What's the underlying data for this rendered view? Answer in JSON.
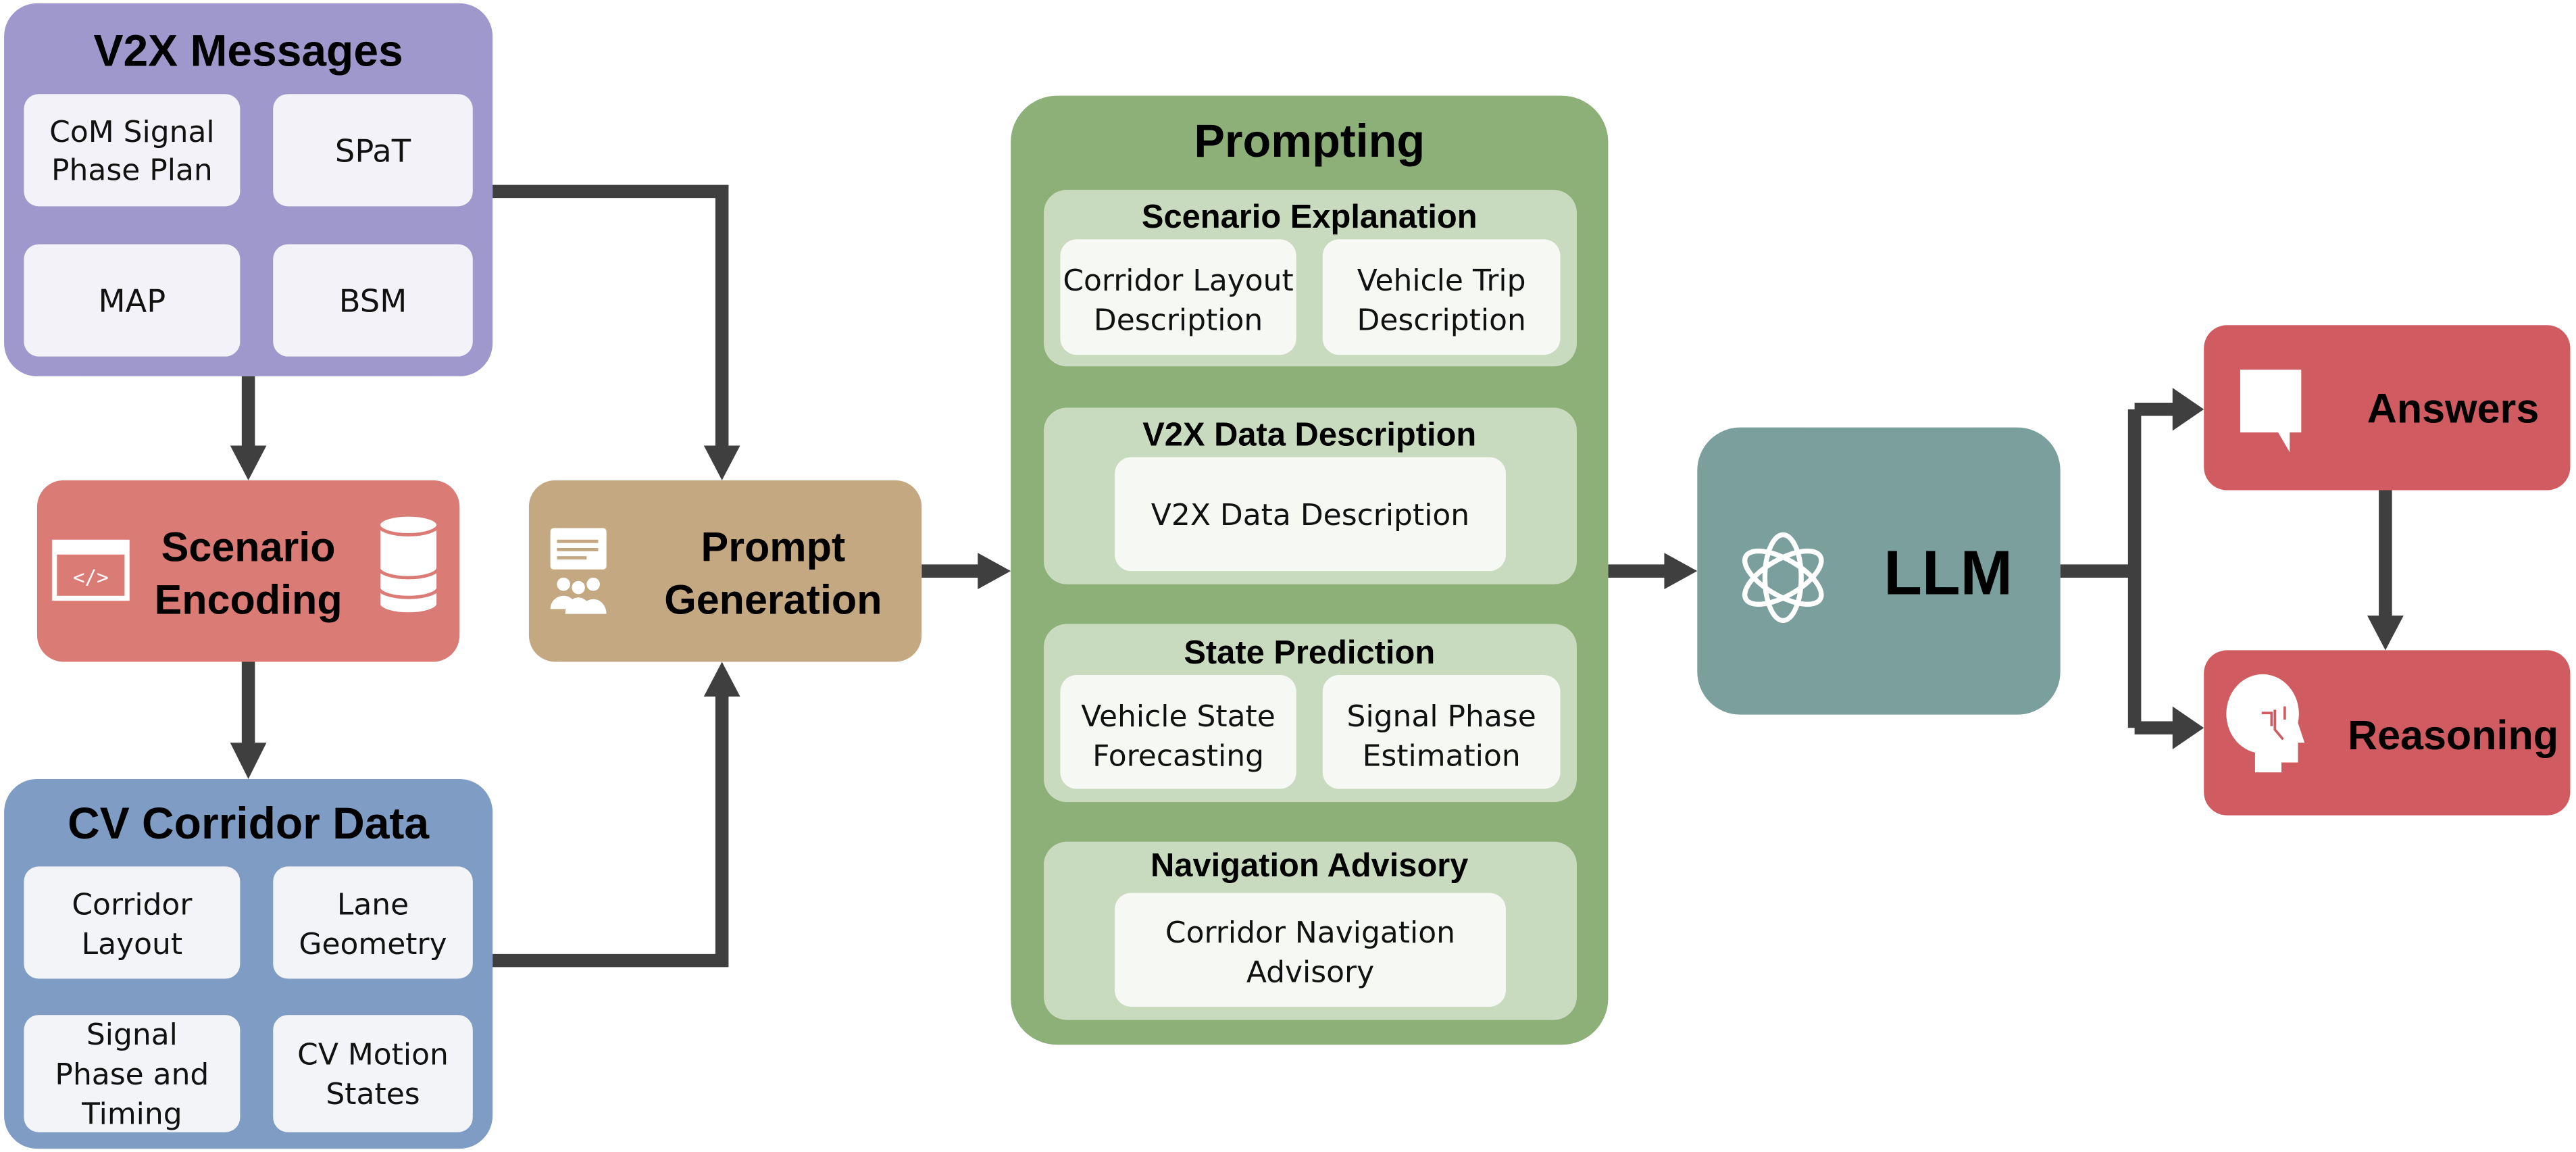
{
  "colors": {
    "v2x": "#9e98cc",
    "encoding": "#db7b76",
    "corridor": "#7f9cc4",
    "prompt_gen": "#c4a882",
    "prompting": "#8daf78",
    "prompting_section": "#c9dbbe",
    "llm": "#7b9f9c",
    "output": "#d05b61",
    "arrow": "#3f3f3f"
  },
  "v2x": {
    "title": "V2X Messages",
    "items": [
      [
        "CoM Signal",
        "Phase Plan"
      ],
      [
        "SPaT"
      ],
      [
        "MAP"
      ],
      [
        "BSM"
      ]
    ]
  },
  "encoding": {
    "title": [
      "Scenario",
      "Encoding"
    ],
    "icons": [
      "code-window-icon",
      "database-icon"
    ]
  },
  "corridor": {
    "title": "CV Corridor Data",
    "items": [
      [
        "Corridor",
        "Layout"
      ],
      [
        "Lane",
        "Geometry"
      ],
      [
        "Signal",
        "Phase and",
        "Timing"
      ],
      [
        "CV Motion",
        "States"
      ]
    ]
  },
  "prompt_gen": {
    "title": [
      "Prompt",
      "Generation"
    ],
    "icon": "people-speech-icon"
  },
  "prompting": {
    "title": "Prompting",
    "sections": [
      {
        "title": "Scenario Explanation",
        "items": [
          [
            "Corridor Layout",
            "Description"
          ],
          [
            "Vehicle Trip",
            "Description"
          ]
        ]
      },
      {
        "title": "V2X Data Description",
        "items": [
          [
            "V2X Data Description"
          ]
        ]
      },
      {
        "title": "State Prediction",
        "items": [
          [
            "Vehicle State",
            "Forecasting"
          ],
          [
            "Signal Phase",
            "Estimation"
          ]
        ]
      },
      {
        "title": "Navigation Advisory",
        "items": [
          [
            "Corridor Navigation",
            "Advisory"
          ]
        ]
      }
    ]
  },
  "llm": {
    "title": "LLM",
    "icon": "openai-logo-icon"
  },
  "answers": {
    "title": "Answers",
    "icon": "speech-bubble-icon"
  },
  "reasoning": {
    "title": "Reasoning",
    "icon": "brain-head-icon"
  }
}
